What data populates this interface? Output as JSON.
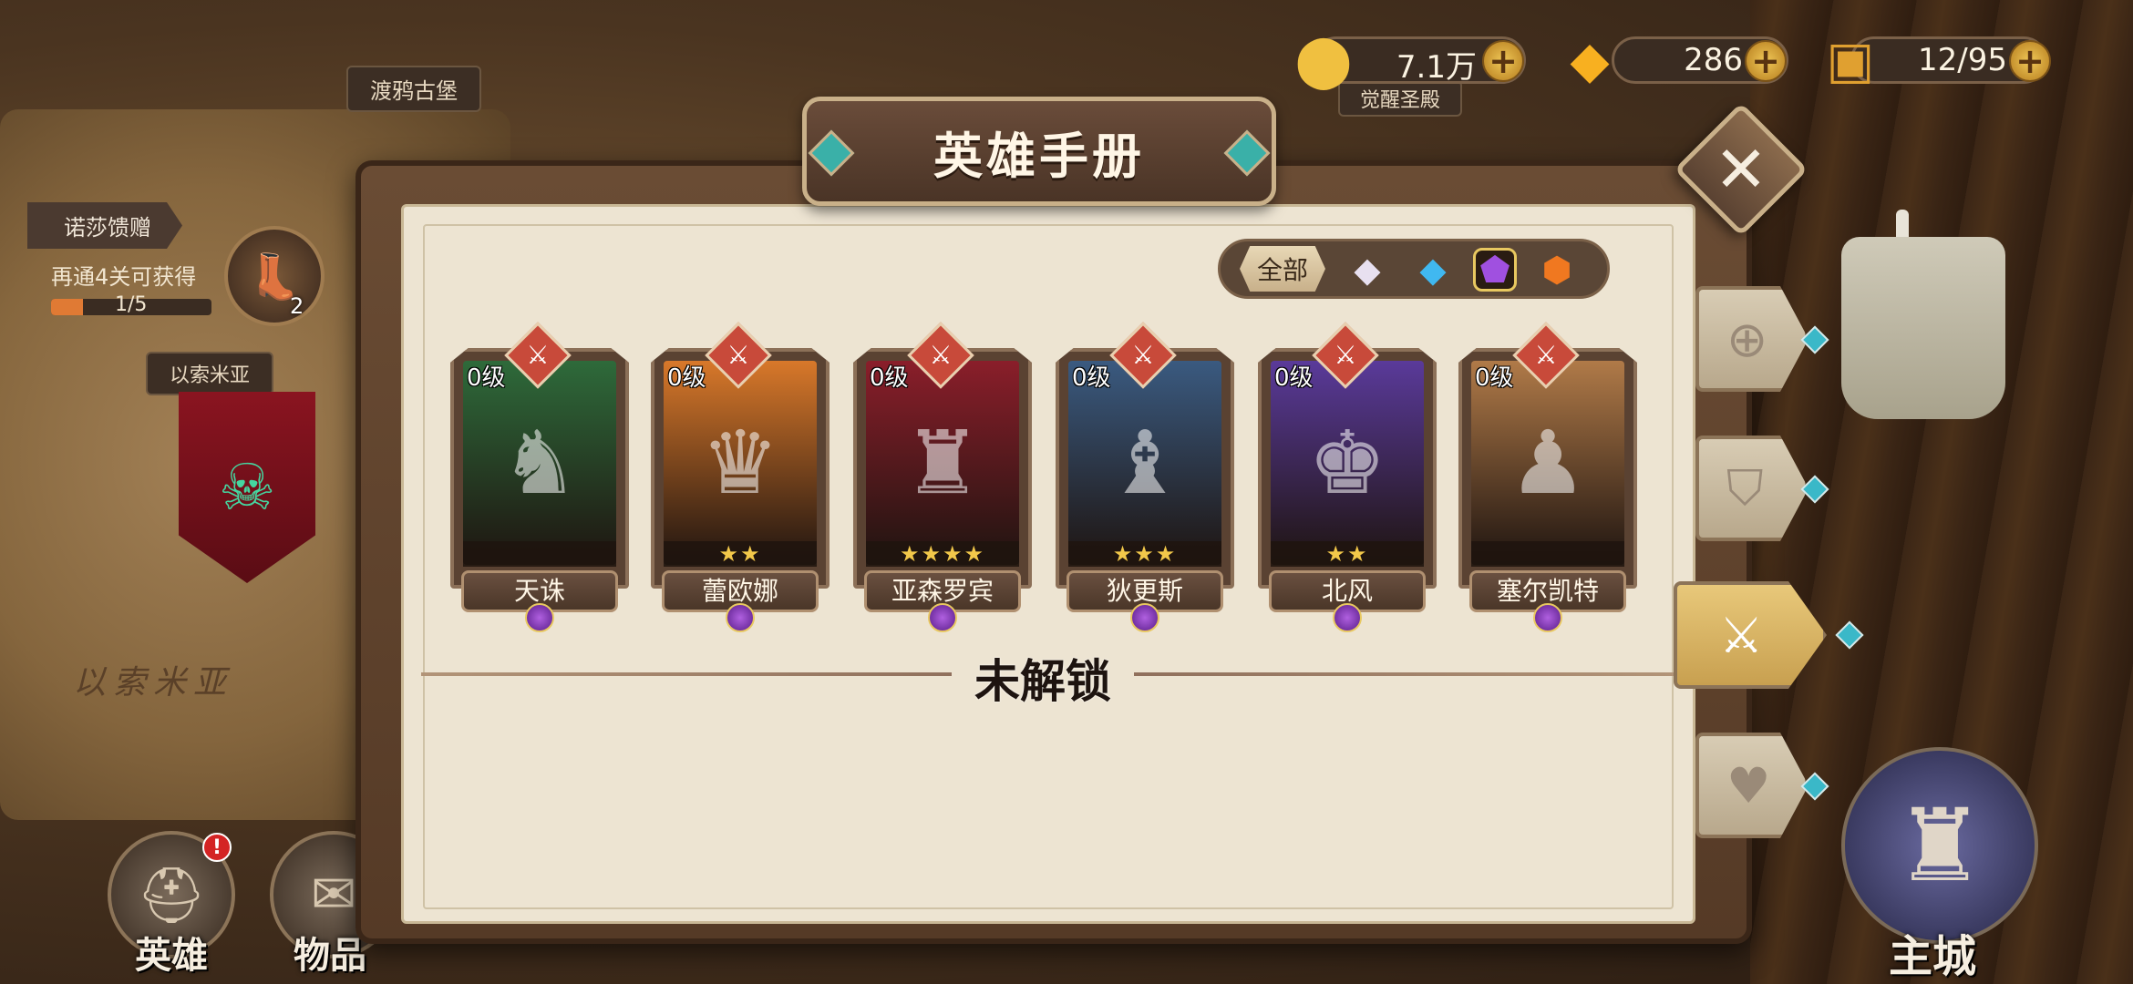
{
  "resources": {
    "gold": {
      "value": "7.1万",
      "icon": "gold-coin-icon"
    },
    "gems": {
      "value": "286",
      "icon": "diamond-icon"
    },
    "stamina": {
      "value": "12/95",
      "icon": "treasure-chest-icon"
    }
  },
  "map": {
    "location_top": "渡鸦古堡",
    "location_right": "觉醒圣殿",
    "region_banner": "以索米亚",
    "region_map_text": "以索米亚"
  },
  "quest": {
    "tab_label": "诺莎馈赠",
    "description": "再通4关可获得",
    "progress_text": "1/5",
    "progress_fraction": 0.2,
    "reward_count": "2"
  },
  "nav": {
    "heroes_label": "英雄",
    "items_label": "物品",
    "main_city_label": "主城",
    "alert_badge": "!"
  },
  "panel": {
    "title": "英雄手册",
    "filter_all": "全部",
    "locked_label": "未解锁"
  },
  "filters": [
    {
      "name": "white-rarity-gem-icon",
      "glyph": "◆",
      "color": "#e8e0f0"
    },
    {
      "name": "blue-rarity-gem-icon",
      "glyph": "◆",
      "color": "#40b8f0"
    },
    {
      "name": "purple-rarity-gem-icon",
      "glyph": "⬟",
      "color": "#a050e0",
      "active": true
    },
    {
      "name": "orange-rarity-gem-icon",
      "glyph": "⬢",
      "color": "#f07820"
    }
  ],
  "heroes": [
    {
      "name": "天诛",
      "level": "0级",
      "stars": 0,
      "art_bg": "#2e6a3a",
      "glyph": "♞"
    },
    {
      "name": "蕾欧娜",
      "level": "0级",
      "stars": 2,
      "art_bg": "#d8782a",
      "glyph": "♛"
    },
    {
      "name": "亚森罗宾",
      "level": "0级",
      "stars": 4,
      "art_bg": "#8a1e2a",
      "glyph": "♜"
    },
    {
      "name": "狄更斯",
      "level": "0级",
      "stars": 3,
      "art_bg": "#3a5a80",
      "glyph": "♝"
    },
    {
      "name": "北风",
      "level": "0级",
      "stars": 2,
      "art_bg": "#5a3a9a",
      "glyph": "♚"
    },
    {
      "name": "塞尔凯特",
      "level": "0级",
      "stars": 0,
      "art_bg": "#b07a48",
      "glyph": "♟"
    }
  ],
  "side_tabs": [
    {
      "name": "tab-all-heroes",
      "icon": "grid-icon",
      "glyph": "⊕",
      "active": false
    },
    {
      "name": "tab-defense",
      "icon": "shield-icon",
      "glyph": "⛉",
      "active": false
    },
    {
      "name": "tab-attack",
      "icon": "sword-icon",
      "glyph": "⚔",
      "active": true
    },
    {
      "name": "tab-support",
      "icon": "heart-icon",
      "glyph": "♥",
      "active": false
    }
  ]
}
